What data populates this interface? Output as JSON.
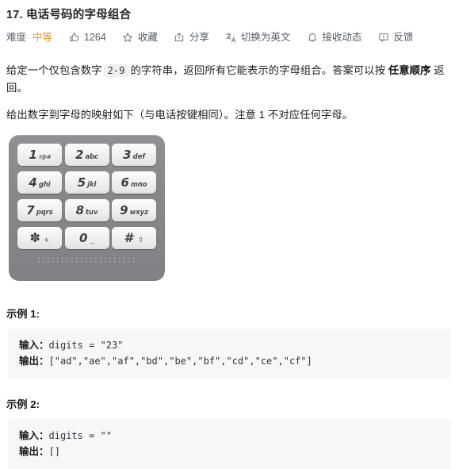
{
  "problem": {
    "title": "17. 电话号码的字母组合"
  },
  "meta": {
    "difficulty_label": "难度",
    "difficulty_value": "中等",
    "difficulty_color": "#f0932b",
    "likes_icon": "thumbs-up-icon",
    "likes_count": "1264",
    "favorite_icon": "star-icon",
    "favorite_label": "收藏",
    "share_icon": "share-icon",
    "share_label": "分享",
    "translate_icon": "translate-icon",
    "translate_label": "切换为英文",
    "subscribe_icon": "bell-icon",
    "subscribe_label": "接收动态",
    "feedback_icon": "feedback-icon",
    "feedback_label": "反馈"
  },
  "description": {
    "p1_a": "给定一个仅包含数字",
    "p1_code": "2-9",
    "p1_b": "的字符串，返回所有它能表示的字母组合。答案可以按",
    "p1_bold": "任意顺序",
    "p1_c": "返回。",
    "p2": "给出数字到字母的映射如下（与电话按键相同）。注意 1 不对应任何字母。"
  },
  "keypad": {
    "rows": [
      [
        {
          "digit": "1",
          "letters": "!@#"
        },
        {
          "digit": "2",
          "letters": "abc"
        },
        {
          "digit": "3",
          "letters": "def"
        }
      ],
      [
        {
          "digit": "4",
          "letters": "ghi"
        },
        {
          "digit": "5",
          "letters": "jkl"
        },
        {
          "digit": "6",
          "letters": "mno"
        }
      ],
      [
        {
          "digit": "7",
          "letters": "pqrs"
        },
        {
          "digit": "8",
          "letters": "tuv"
        },
        {
          "digit": "9",
          "letters": "wxyz"
        }
      ],
      [
        {
          "digit": "✽",
          "letters": "+"
        },
        {
          "digit": "0",
          "letters": "_"
        },
        {
          "digit": "#",
          "letters": "⇧"
        }
      ]
    ]
  },
  "examples": [
    {
      "title": "示例 1:",
      "input_label": "输入：",
      "input_value": "digits = \"23\"",
      "output_label": "输出：",
      "output_value": "[\"ad\",\"ae\",\"af\",\"bd\",\"be\",\"bf\",\"cd\",\"ce\",\"cf\"]"
    },
    {
      "title": "示例 2:",
      "input_label": "输入：",
      "input_value": "digits = \"\"",
      "output_label": "输出：",
      "output_value": "[]"
    }
  ]
}
